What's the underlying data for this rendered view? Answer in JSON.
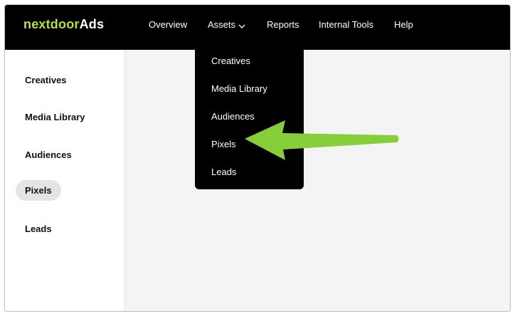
{
  "brand": {
    "word": "nextdoor",
    "suffix": "Ads"
  },
  "nav": {
    "overview": "Overview",
    "assets": "Assets",
    "reports": "Reports",
    "internal_tools": "Internal Tools",
    "help": "Help"
  },
  "assets_menu": [
    "Creatives",
    "Media Library",
    "Audiences",
    "Pixels",
    "Leads"
  ],
  "sidebar": {
    "items": [
      "Creatives",
      "Media Library",
      "Audiences",
      "Pixels",
      "Leads"
    ],
    "active": "Pixels"
  },
  "colors": {
    "brand_green": "#b4e046",
    "annotation_arrow": "#86cf3a",
    "topbar": "#000000",
    "content_bg": "#f4f4f4"
  },
  "icons": {
    "assets_dropdown": "chevron-down-icon",
    "annotation": "arrow-left-icon"
  }
}
